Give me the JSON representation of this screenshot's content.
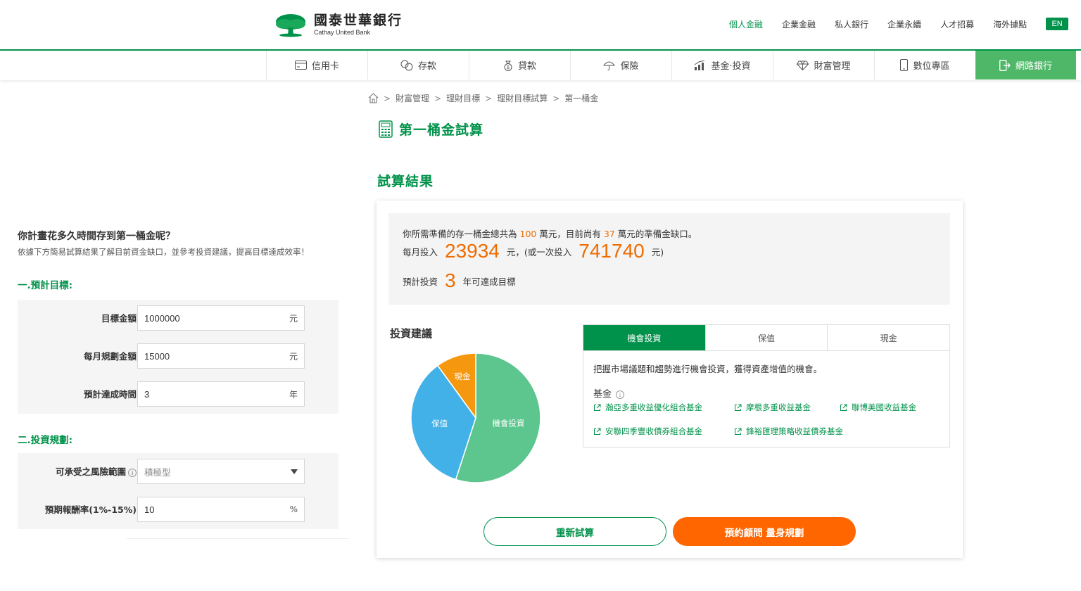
{
  "header": {
    "logo_zh": "國泰世華銀行",
    "logo_en": "Cathay United Bank",
    "top_links": [
      "個人金融",
      "企業金融",
      "私人銀行",
      "企業永續",
      "人才招募",
      "海外據點"
    ],
    "lang_button": "EN",
    "brand_color": "#00924a"
  },
  "main_nav": {
    "items": [
      "信用卡",
      "存款",
      "貸款",
      "保險",
      "基金·投資",
      "財富管理",
      "數位專區"
    ],
    "online_banking": "網路銀行"
  },
  "breadcrumb": [
    "財富管理",
    "理財目標",
    "理財目標試算",
    "第一桶金"
  ],
  "page_title": "第一桶金試算",
  "result_title": "試算結果",
  "left": {
    "question": "你計畫花多久時間存到第一桶金呢？",
    "description": "依據下方簡易試算結果了解目前資金缺口，並參考投資建議，提高目標達成效率！",
    "section1": "一.預計目標:",
    "section2": "二.投資規劃:",
    "fields": {
      "target_label": "目標金額",
      "target_value": "1000000",
      "target_unit": "元",
      "monthly_label": "每月規劃金額",
      "monthly_value": "15000",
      "monthly_unit": "元",
      "years_label": "預計達成時間",
      "years_value": "3",
      "years_unit": "年",
      "risk_label": "可承受之風險範圍",
      "risk_value": "積極型",
      "return_label": "預期報酬率(1%-15%)",
      "return_value": "10",
      "return_unit": "%"
    }
  },
  "summary": {
    "line1_a": "你所需準備的存一桶金總共為",
    "total": "100",
    "line1_b": "萬元，目前尚有",
    "gap": "37",
    "line1_c": "萬元的準備金缺口。",
    "monthly_prefix": "每月投入",
    "monthly_amount": "23934",
    "monthly_mid": "元，(或一次投入",
    "lump_sum": "741740",
    "monthly_suffix": "元)",
    "years_prefix": "預計投資",
    "years": "3",
    "years_suffix": "年可達成目標"
  },
  "advice": {
    "title": "投資建議",
    "tabs": [
      "機會投資",
      "保值",
      "現金"
    ],
    "active_tab": "機會投資",
    "panel_desc": "把握市場議題和趨勢進行機會投資，獲得資產增值的機會。",
    "fund_label": "基金",
    "funds": [
      "瀚亞多重收益優化組合基金",
      "摩根多重收益基金",
      "聯博美國收益基金",
      "安聯四季豐收債券組合基金",
      "鋒裕匯理策略收益債券基金"
    ]
  },
  "chart_data": {
    "type": "pie",
    "labels": [
      "機會投資",
      "保值",
      "現金"
    ],
    "values": [
      55,
      35,
      10
    ],
    "colors": [
      "#5dc58e",
      "#41b1e8",
      "#f5980f"
    ]
  },
  "buttons": {
    "recalc": "重新試算",
    "consult": "預約顧問 量身規劃"
  }
}
